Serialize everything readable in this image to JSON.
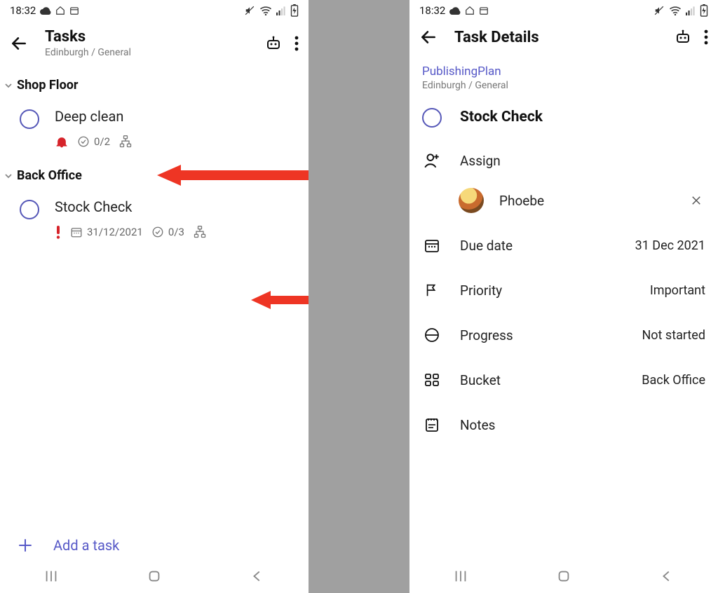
{
  "status": {
    "time": "18:32"
  },
  "left": {
    "appbar": {
      "title": "Tasks",
      "subtitle": "Edinburgh / General"
    },
    "sections": [
      {
        "title": "Shop Floor",
        "tasks": [
          {
            "title": "Deep clean",
            "checklist": "0/2",
            "bell": true,
            "subtasks": true
          }
        ]
      },
      {
        "title": "Back Office",
        "tasks": [
          {
            "title": "Stock Check",
            "priority": true,
            "due": "31/12/2021",
            "checklist": "0/3",
            "subtasks": true
          }
        ]
      }
    ],
    "add_task": "Add a task"
  },
  "right": {
    "appbar": {
      "title": "Task Details"
    },
    "plan": {
      "name": "PublishingPlan",
      "path": "Edinburgh / General"
    },
    "task_title": "Stock Check",
    "rows": {
      "assign_label": "Assign",
      "assignee": "Phoebe",
      "due_label": "Due date",
      "due_value": "31 Dec 2021",
      "priority_label": "Priority",
      "priority_value": "Important",
      "progress_label": "Progress",
      "progress_value": "Not started",
      "bucket_label": "Bucket",
      "bucket_value": "Back Office",
      "notes_label": "Notes"
    }
  }
}
